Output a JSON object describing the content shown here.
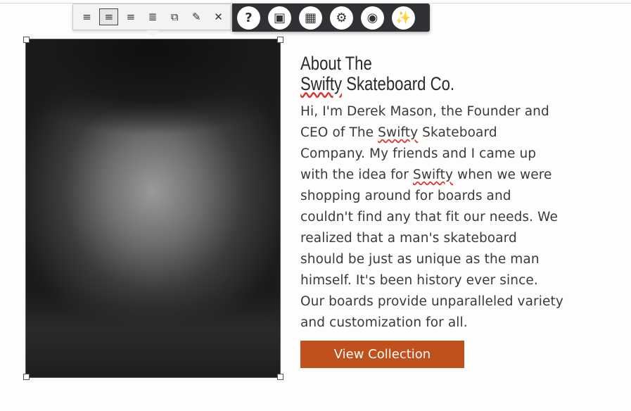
{
  "image_toolbar": {
    "buttons": [
      {
        "name": "align-left-icon",
        "glyph": "≡"
      },
      {
        "name": "align-center-icon",
        "glyph": "≡",
        "active": true
      },
      {
        "name": "align-right-icon",
        "glyph": "≡"
      },
      {
        "name": "align-inline-icon",
        "glyph": "≣"
      },
      {
        "name": "replace-image-icon",
        "glyph": "⧉"
      },
      {
        "name": "edit-pencil-icon",
        "glyph": "✎"
      },
      {
        "name": "close-icon",
        "glyph": "✕"
      }
    ]
  },
  "builder_toolbar": {
    "buttons": [
      {
        "name": "help-icon",
        "glyph": "?"
      },
      {
        "name": "image-icon",
        "glyph": "▣"
      },
      {
        "name": "layout-icon",
        "glyph": "▦"
      },
      {
        "name": "settings-gear-icon",
        "glyph": "⚙"
      },
      {
        "name": "camera-icon",
        "glyph": "◉"
      },
      {
        "name": "magic-wand-icon",
        "glyph": "✨"
      }
    ]
  },
  "content": {
    "heading_line1": "About The",
    "heading_line2_brand": "Swifty",
    "heading_line2_rest": " Skateboard Co.",
    "body": {
      "p1": "Hi, I'm Derek Mason, the Founder and CEO of The ",
      "brand1": "Swifty",
      "p2": " Skateboard Company. My friends and I came up with the idea for ",
      "brand2": "Swifty",
      "p3": " when we were shopping around for boards and couldn't find any that fit our needs. We realized that a man's skateboard should be just as unique as the man himself. It's been history ever since. Our boards provide unparalleled variety and customization for all."
    },
    "cta_label": "View Collection"
  },
  "colors": {
    "accent": "#c0501c",
    "toolbar_dark": "#2f3135"
  }
}
